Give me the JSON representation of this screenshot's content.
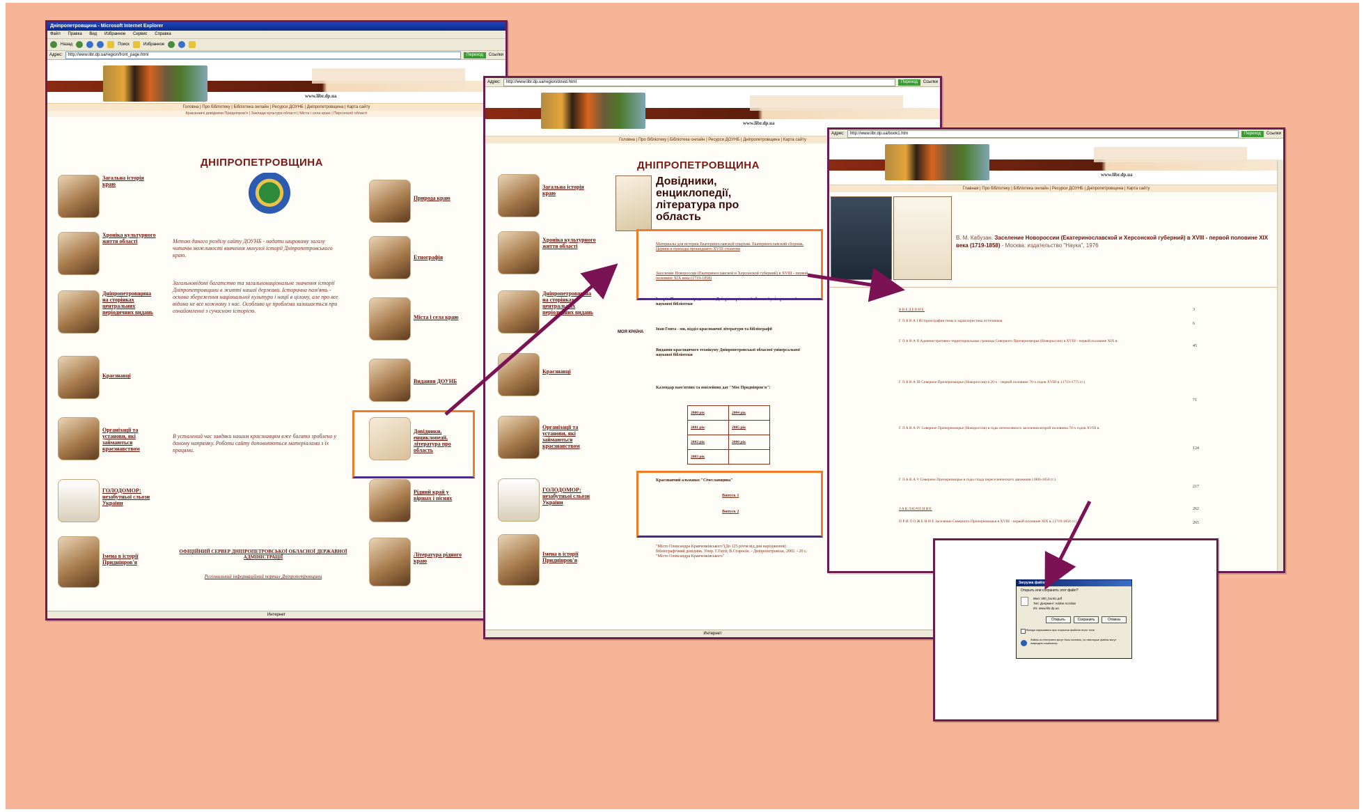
{
  "window1": {
    "title": "Дніпропетровщина - Microsoft Internet Explorer",
    "menu": [
      "Файл",
      "Правка",
      "Вид",
      "Избранное",
      "Сервис",
      "Справка"
    ],
    "toolbar": {
      "back": "Назад",
      "search": "Поиск",
      "favorites": "Избранное"
    },
    "address_label": "Адрес:",
    "address": "http://www.libr.dp.ua/region/front_page.html",
    "go_label": "Переход",
    "links_label": "Ссылки",
    "site_name": "www.libr.dp.ua",
    "nav": "Головна | Про бібліотеку | Бібліотека онлайн | Ресурси ДОУНБ | Дніпропетровщина | Карта сайту",
    "subnav": "Краєзнавчі довідники Придніпров'я | Заклади культури області | Міста і села краю | Персоналії області",
    "page_title": "ДНІПРОПЕТРОВЩИНА",
    "left_tiles": [
      "Загальна історія краю",
      "Хроніка культурного життя області",
      "Дніпропетровщина на сторінках центральних періодичних видань",
      "Краєзнавці",
      "Організації та установи, які займаються краєзнавством",
      "ГОЛОДОМОР: незабутньої сльози України",
      "Імена в історії Придніпров'я"
    ],
    "right_tiles": [
      "Природа краю",
      "Етнографія",
      "Міста і села краю",
      "Видання ДОУНБ",
      "Довідники, енциклопедії, література про область",
      "Рідний край у віршах і піснях",
      "Література рідного краю"
    ],
    "intro_text": "Метою даного розділу сайту ДОУНБ - надати широкому загалу читачів можливості вивчення минулої історії Дніпропетровського краю.",
    "body_text": "Загальновідомі багатство та загальнонаціональне значення історії Дніпропетровщини в житті нашої держави. Історична пам'ять - основа збереження національної культури і нації в цілому, але про все відомо не все кожному з нас. Особливо це проблема залишається при ознайомленні з сучасною історією.",
    "appeal_text": "В усталений час завдяки нашим краєзнавцям вже багато зроблено у даному напрямку. Роботи сайту доповнюються матеріалами з їх працями.",
    "footer_org": "ОФІЦІЙНИЙ СЕРВЕР ДНІПРОПЕТРОВСЬКОЇ ОБЛАСНОЇ ДЕРЖАВНОЇ АДМІНІСТРАЦІЇ",
    "footer_portal": "Регіональний інформаційний портал Дніпропетровщини",
    "status": "Интернет"
  },
  "window2": {
    "address_label": "Адрес:",
    "address": "http://www.libr.dp.ua/region/dovid.html",
    "go_label": "Переход",
    "links_label": "Ссылки",
    "site_name": "www.libr.dp.ua",
    "nav": "Головна | Про бібліотеку | Бібліотека онлайн | Ресурси ДОУНБ | Дніпропетровщина | Карта сайту",
    "page_title": "ДНІПРОПЕТРОВЩИНА",
    "section_title": "Довідники, енциклопедії, література про область",
    "left_tiles": [
      "Загальна історія краю",
      "Хроніка культурного життя області",
      "Дніпропетровщина на сторінках центральних періодичних видань",
      "Краєзнавці",
      "Організації та установи, які займаються краєзнавством",
      "ГОЛОДОМОР: незабутньої сльози України",
      "Імена в історії Придніпров'я"
    ],
    "doc_links": [
      "Материалы для истории Екатеринославской епархии. Екатеринославский сборник. Церкви и приходы прошедшего XVIII столетия",
      "Заселение Новороссии (Екатеринославской и Херсонской губерний) в XVIII - первой половине XIX века (1719-1858)"
    ],
    "bullets": [
      "Історія Полтави стародавнього Дніпропетровської обласної універсальної наукової бібліотеки",
      "Іван Гонта - ми, відділ краєзнавчої літератури та бібліографії",
      "Видання краєзнавчого технікуму Дніпропетровської обласної універсальної наукової бібліотеки"
    ],
    "side_label": "МОЯ КРАЇНА",
    "calendar_label": "Календар пам'ятних та ювілейних дат \"Моє Придніпров'я\":",
    "years": [
      [
        "2000 рік",
        "2004 рік"
      ],
      [
        "2001 рік",
        "2005 рік"
      ],
      [
        "2002 рік",
        "2006 рік"
      ],
      [
        "2003 рік",
        ""
      ]
    ],
    "almanac_label": "Краєзнавчий альманах \"Січеславщина\"",
    "issues": [
      "Випуск 1",
      "Випуск 2"
    ],
    "footnote": "\"Місто Олександра Кравченківського\"(До 125 річчя від дня народження): бібліографічний довідник. Упор. Г.Гнуй; В.Старосін. - Дніпропетровськ, 2002. - 20 с. \"Місто Олександра Кравченківського\"",
    "status": "Интернет"
  },
  "window3": {
    "address_label": "Адрес:",
    "address": "http://www.libr.dp.ua/book1.htm",
    "go_label": "Переход",
    "links_label": "Ссылки",
    "site_name": "www.libr.dp.ua",
    "nav": "Главная | Про бібліотеку | Бібліотека онлайн | Ресурси ДОУНБ | Дніпропетровщина | Карта сайту",
    "book_author": "В. М. Кабузан.",
    "book_title": "Заселение Новороссии (Екатеринославской и Херсонской губерний) в XVIII - первой половине XIX века (1719-1858)",
    "book_publisher": "- Москва: издательство \"Наука\", 1976",
    "toc": [
      {
        "label": "ВВЕДЕНИЕ",
        "page": "3"
      },
      {
        "label": "Г Л А В А I Историография темы и характеристика источников",
        "page": "6"
      },
      {
        "label": "Г Л А В А II Административно-территориальные границы Северного Причерноморья (Новороссии) в XVIII - первой половине XIX в.",
        "page": "45"
      },
      {
        "label": "Г Л А В А III Северное Причерноморье (Новороссия) в 20-х - первой половине 70-х годов XVIII в. (1719-1775 гг.)",
        "page": "71"
      },
      {
        "label": "Г Л А В А IV Северное Причерноморье (Новороссия) в годы интенсивного заселения второй половины 70-х годов XVIII в.",
        "page": "124"
      },
      {
        "label": "Г Л А В А V Северное Причерноморье в годы спада переселенческого движения (1800-1858 гг.)",
        "page": "217"
      },
      {
        "label": "ЗАКЛЮЧЕНИЕ",
        "page": "262"
      },
      {
        "label": "П Р И Л О Ж Е Н И Е Заселение Северного Причерноморья в XVIII - первой половине XIX в. (1719-1858 гг.)",
        "page": "265"
      }
    ]
  },
  "dialog": {
    "title": "Загрузка файла",
    "question": "Открыть или сохранить этот файл?",
    "file_info": [
      "Имя: 300_book1.pdf",
      "Тип: Документ Adobe Acrobat",
      "Из: www.libr.dp.ua"
    ],
    "buttons": [
      "Открыть",
      "Сохранить",
      "Отмена"
    ],
    "checkbox": "Всегда спрашивать при открытии файлов этого типа",
    "warning": "Файлы из Интернета могут быть полезны, но некоторые файлы могут повредить компьютер."
  },
  "colors": {
    "background": "#f6b597",
    "window_border": "#6b1d4f",
    "highlight_orange": "#f07c28",
    "highlight_purple": "#4a2a8a",
    "link": "#6a1208",
    "arrow": "#7a1254"
  }
}
